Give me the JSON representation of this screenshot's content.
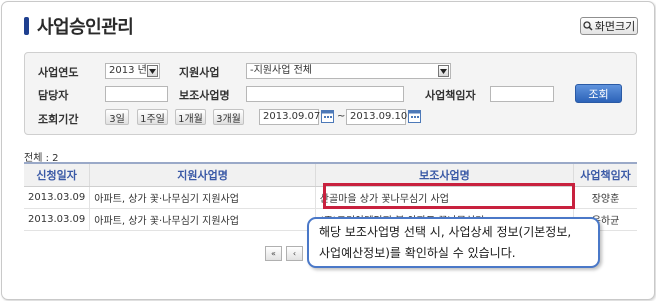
{
  "page": {
    "title": "사업승인관리",
    "zoom_label": "화면크기"
  },
  "search": {
    "year_label": "사업연도",
    "year_value": "2013 년",
    "support_label": "지원사업",
    "support_value": "-지원사업 전체",
    "manager_label": "담당자",
    "manager_value": "",
    "sub_project_label": "보조사업명",
    "sub_project_value": "",
    "owner_label": "사업책임자",
    "owner_value": "",
    "query_button": "조회",
    "period_label": "조회기간",
    "period_buttons": [
      "3일",
      "1주일",
      "1개월",
      "3개월"
    ],
    "date_from": "2013.09.07",
    "date_to": "2013.09.10",
    "tilde": "~"
  },
  "list": {
    "total": "전체 : 2",
    "columns": [
      "신청일자",
      "지원사업명",
      "보조사업명",
      "사업책임자"
    ],
    "rows": [
      [
        "2013.03.09",
        "아파트, 상가 꽃·나무심기 지원사업",
        "산골마을 상가 꽃나무심기 사업",
        "장양훈"
      ],
      [
        "2013.03.09",
        "아파트, 상가 꽃·나무심기 지원사업",
        "(주)코리아텍단지 봄 아파트 꽃나무심기",
        "옥하균"
      ]
    ]
  },
  "pager": {
    "first": "«",
    "prev": "‹"
  },
  "callout": {
    "line1": "해당 보조사업명 선택 시, 사업상세 정보(기본정보,",
    "line2": "사업예산정보)를 확인하실 수 있습니다."
  },
  "colors": {
    "accent": "#3a59a6",
    "highlight": "#c8213e",
    "callout_border": "#4a78c8",
    "query_button": "#2c63b8"
  }
}
